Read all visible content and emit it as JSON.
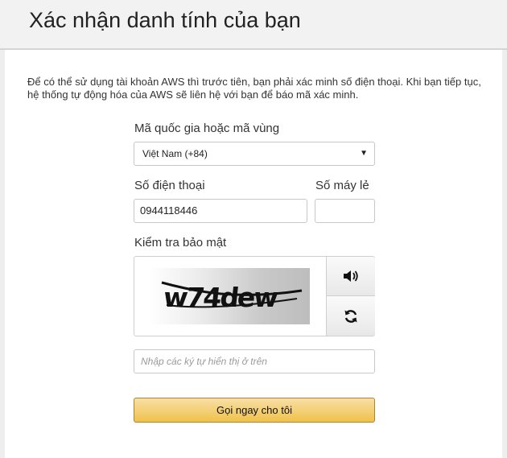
{
  "header": {
    "title": "Xác nhận danh tính của bạn"
  },
  "intro": {
    "text": "Để có thể sử dụng tài khoản AWS thì trước tiên, bạn phải xác minh số điện thoại. Khi bạn tiếp tục, hệ thống tự động hóa của AWS sẽ liên hệ với bạn để báo mã xác minh."
  },
  "form": {
    "country_label": "Mã quốc gia hoặc mã vùng",
    "country_value": "Việt Nam (+84)",
    "phone_label": "Số điện thoại",
    "phone_value": "0944118446",
    "extension_label": "Số máy lẻ",
    "extension_value": "",
    "security_label": "Kiểm tra bảo mật",
    "captcha_text": "w74dew",
    "captcha_placeholder": "Nhập các ký tự hiển thị ở trên",
    "submit_label": "Gọi ngay cho tôi"
  },
  "icons": {
    "audio": "speaker-icon",
    "refresh": "refresh-icon",
    "dropdown": "caret-down-icon"
  },
  "colors": {
    "button_top": "#f7dfa5",
    "button_bottom": "#f0c14b",
    "button_border": "#a88734"
  }
}
